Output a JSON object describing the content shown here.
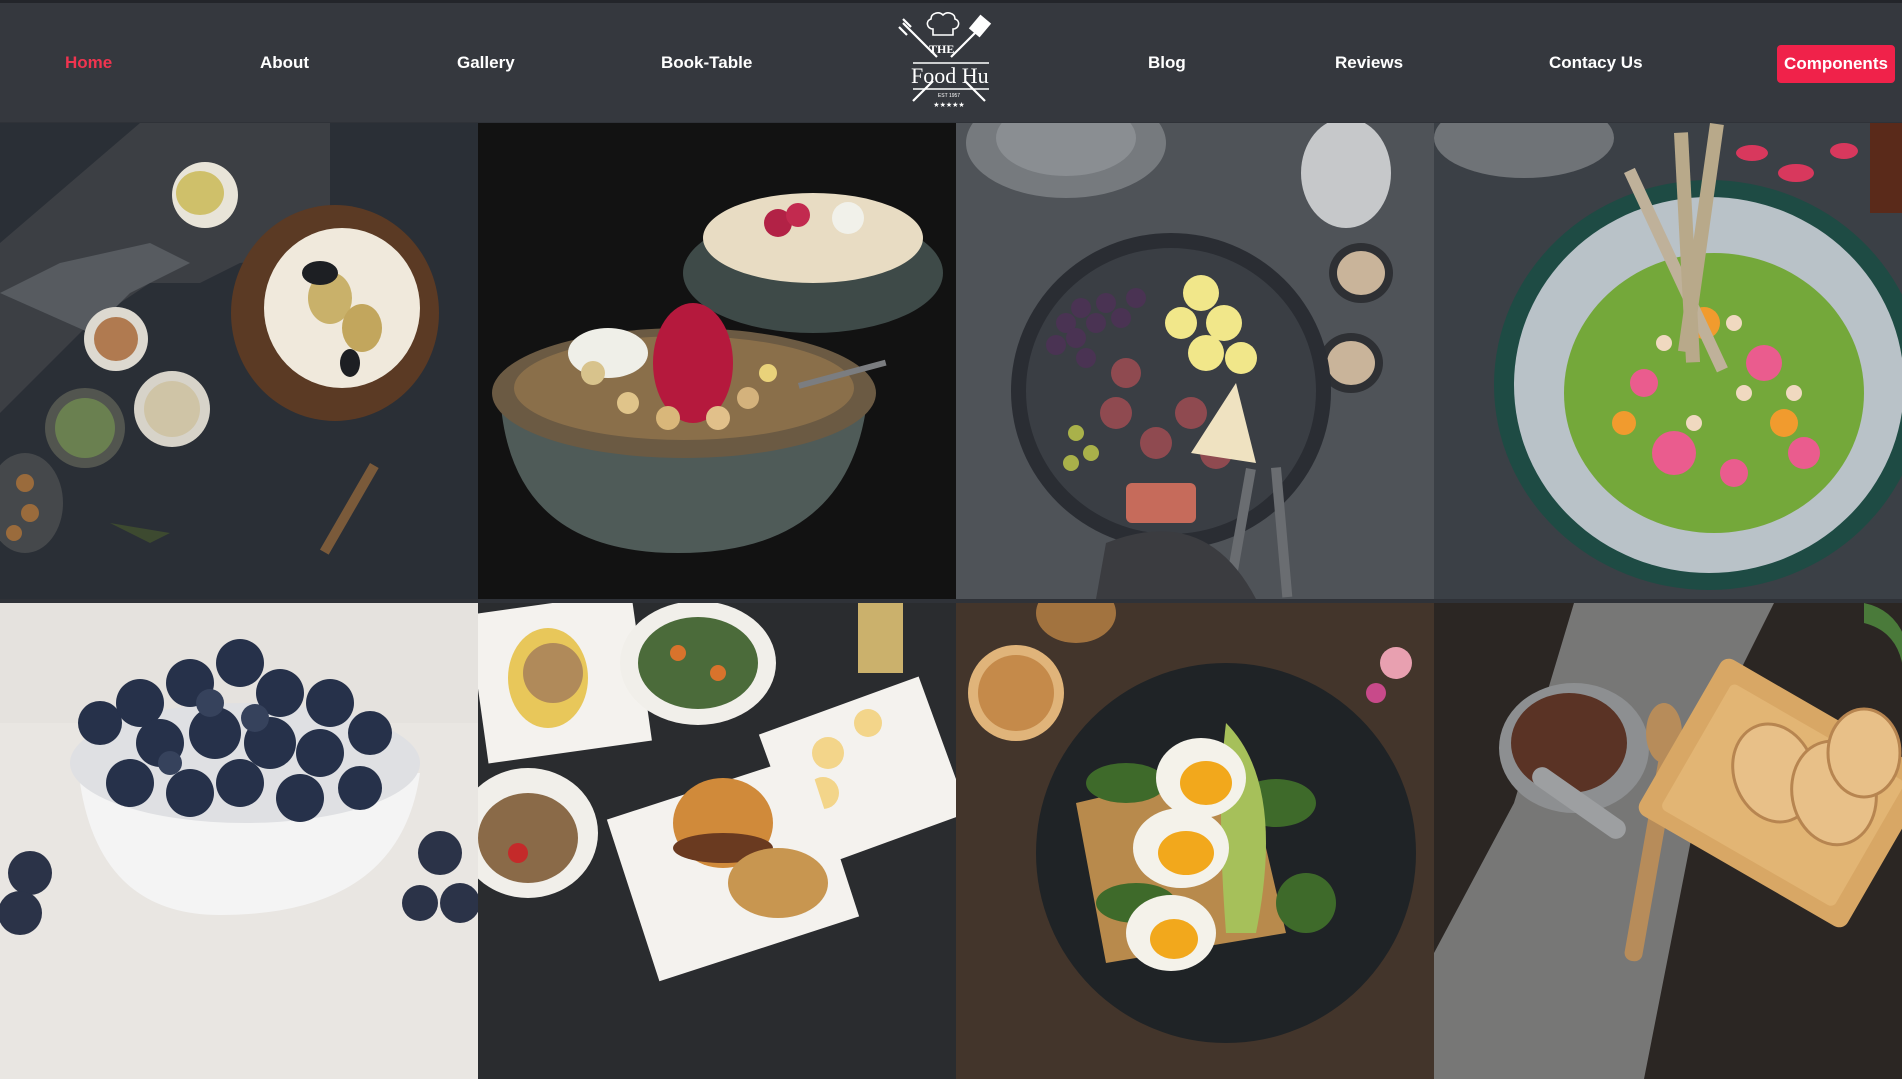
{
  "nav": {
    "left_links": [
      "Home",
      "About",
      "Gallery",
      "Book-Table"
    ],
    "right_links": [
      "Blog",
      "Reviews",
      "Contacy Us"
    ],
    "active": "Home",
    "cta_label": "Components"
  },
  "logo": {
    "word_the": "THE",
    "word_name": "Food Hu",
    "est": "EST 1957",
    "stars": "★★★★★",
    "icon": "chef-hat-utensils-icon"
  },
  "gallery": {
    "tiles": [
      "pear-cake-dessert-photo",
      "granola-bowl-photo",
      "figs-grape-platter-photo",
      "green-hummus-bowl-photo",
      "blueberries-bowl-photo",
      "plated-dishes-burger-photo",
      "avocado-egg-toast-photo",
      "cocoa-cookies-photo"
    ]
  },
  "colors": {
    "navbar": "#35383e",
    "accent": "#f0224a",
    "active_link": "#f0344f",
    "link": "#ffffff"
  }
}
